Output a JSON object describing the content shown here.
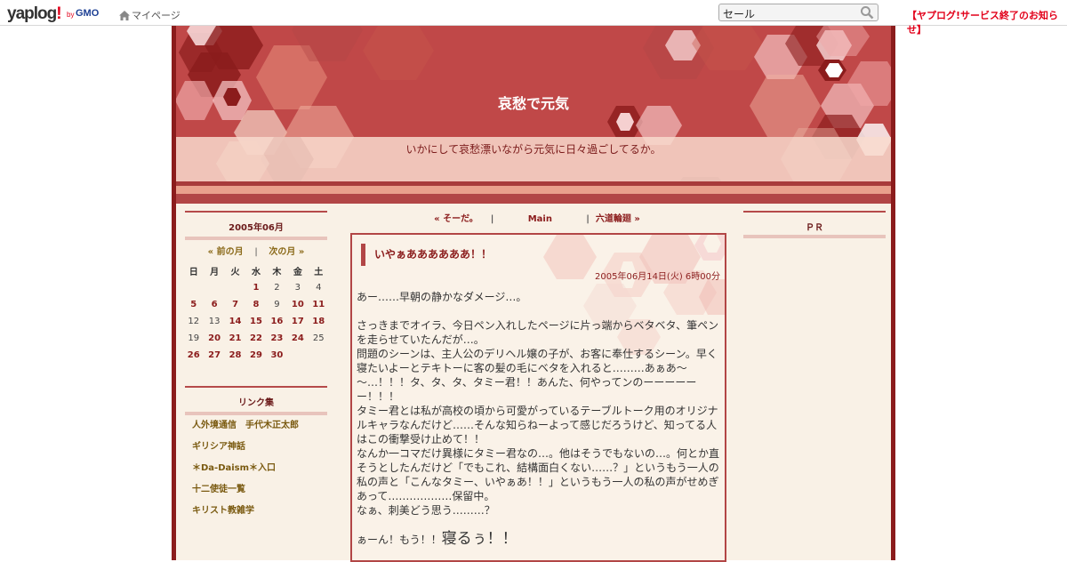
{
  "topbar": {
    "logo_main": "yaplog",
    "logo_bang": "!",
    "logo_by": "by",
    "logo_gmo": "GMO",
    "mypage_label": "マイページ",
    "search_value": "セール",
    "notice": "【ヤプログ!サービス終了のお知らせ】"
  },
  "header": {
    "title": "哀愁で元気",
    "tagline": "いかにして哀愁漂いながら元気に日々過ごしてるか。"
  },
  "calendar": {
    "heading": "2005年06月",
    "prev": "« 前の月",
    "sep": "|",
    "next": "次の月 »",
    "weekdays": [
      "日",
      "月",
      "火",
      "水",
      "木",
      "金",
      "土"
    ],
    "weeks": [
      [
        {
          "d": ""
        },
        {
          "d": ""
        },
        {
          "d": ""
        },
        {
          "d": "1",
          "l": true
        },
        {
          "d": "2"
        },
        {
          "d": "3"
        },
        {
          "d": "4"
        }
      ],
      [
        {
          "d": "5",
          "l": true
        },
        {
          "d": "6",
          "l": true
        },
        {
          "d": "7",
          "l": true
        },
        {
          "d": "8",
          "l": true
        },
        {
          "d": "9"
        },
        {
          "d": "10",
          "l": true
        },
        {
          "d": "11",
          "l": true
        }
      ],
      [
        {
          "d": "12"
        },
        {
          "d": "13"
        },
        {
          "d": "14",
          "l": true
        },
        {
          "d": "15",
          "l": true
        },
        {
          "d": "16",
          "l": true
        },
        {
          "d": "17",
          "l": true
        },
        {
          "d": "18",
          "l": true
        }
      ],
      [
        {
          "d": "19"
        },
        {
          "d": "20",
          "l": true
        },
        {
          "d": "21",
          "l": true
        },
        {
          "d": "22",
          "l": true
        },
        {
          "d": "23",
          "l": true
        },
        {
          "d": "24",
          "l": true
        },
        {
          "d": "25"
        }
      ],
      [
        {
          "d": "26",
          "l": true
        },
        {
          "d": "27",
          "l": true
        },
        {
          "d": "28",
          "l": true
        },
        {
          "d": "29",
          "l": true
        },
        {
          "d": "30",
          "l": true
        },
        {
          "d": ""
        },
        {
          "d": ""
        }
      ]
    ]
  },
  "links": {
    "heading": "リンク集",
    "items": [
      "人外境通信　手代木正太郎",
      "ギリシア神話",
      "＊Da-Daism＊入口",
      "十二使徒一覧",
      "キリスト教雑学"
    ]
  },
  "main_nav": {
    "prev": "« そーだ。",
    "sep1": "|",
    "main": "Main",
    "sep2": "|",
    "next": "六道輪廻 »"
  },
  "entry": {
    "title": "いやぁああああああ！！",
    "date": "2005年06月14日(火) 6時00分",
    "p1": "あー……早朝の静かなダメージ…。",
    "p2": "さっきまでオイラ、今日ペン入れしたページに片っ端からベタベタ、筆ペンを走らせていたんだが…。",
    "p3": "問題のシーンは、主人公のデリヘル嬢の子が、お客に奉仕するシーン。早く寝たいよーとテキトーに客の髪の毛にベタを入れると………あぁあ～～…！！！タ、タ、タ、タミー君！！あんた、何やってンのーーーーーー！！！",
    "p4": "タミー君とは私が高校の頃から可愛がっているテーブルトーク用のオリジナルキャラなんだけど……そんな知らねーよって感じだろうけど、知ってる人はこの衝撃受け止めて！！",
    "p5": "なんか一コマだけ異様にタミー君なの…。他はそうでもないの…。何とか直そうとしたんだけど「でもこれ、結構面白くない……？」というもう一人の私の声と「こんなタミー、いやぁあ！！」というもう一人の私の声がせめぎあって………………保留中。",
    "p6": "なぁ、刺美どう思う………？",
    "p7a": "ぁーん！もう！！",
    "p7b": "寝るぅ！！"
  },
  "pr": {
    "heading": "ＰＲ"
  },
  "colors": {
    "frame_border": "#8b1c1c",
    "header_bg": "#c04848",
    "link_gold": "#7a5a10",
    "link_red": "#8b1c1c",
    "notice_red": "#e2001a",
    "page_bg": "#f9f1e6"
  }
}
